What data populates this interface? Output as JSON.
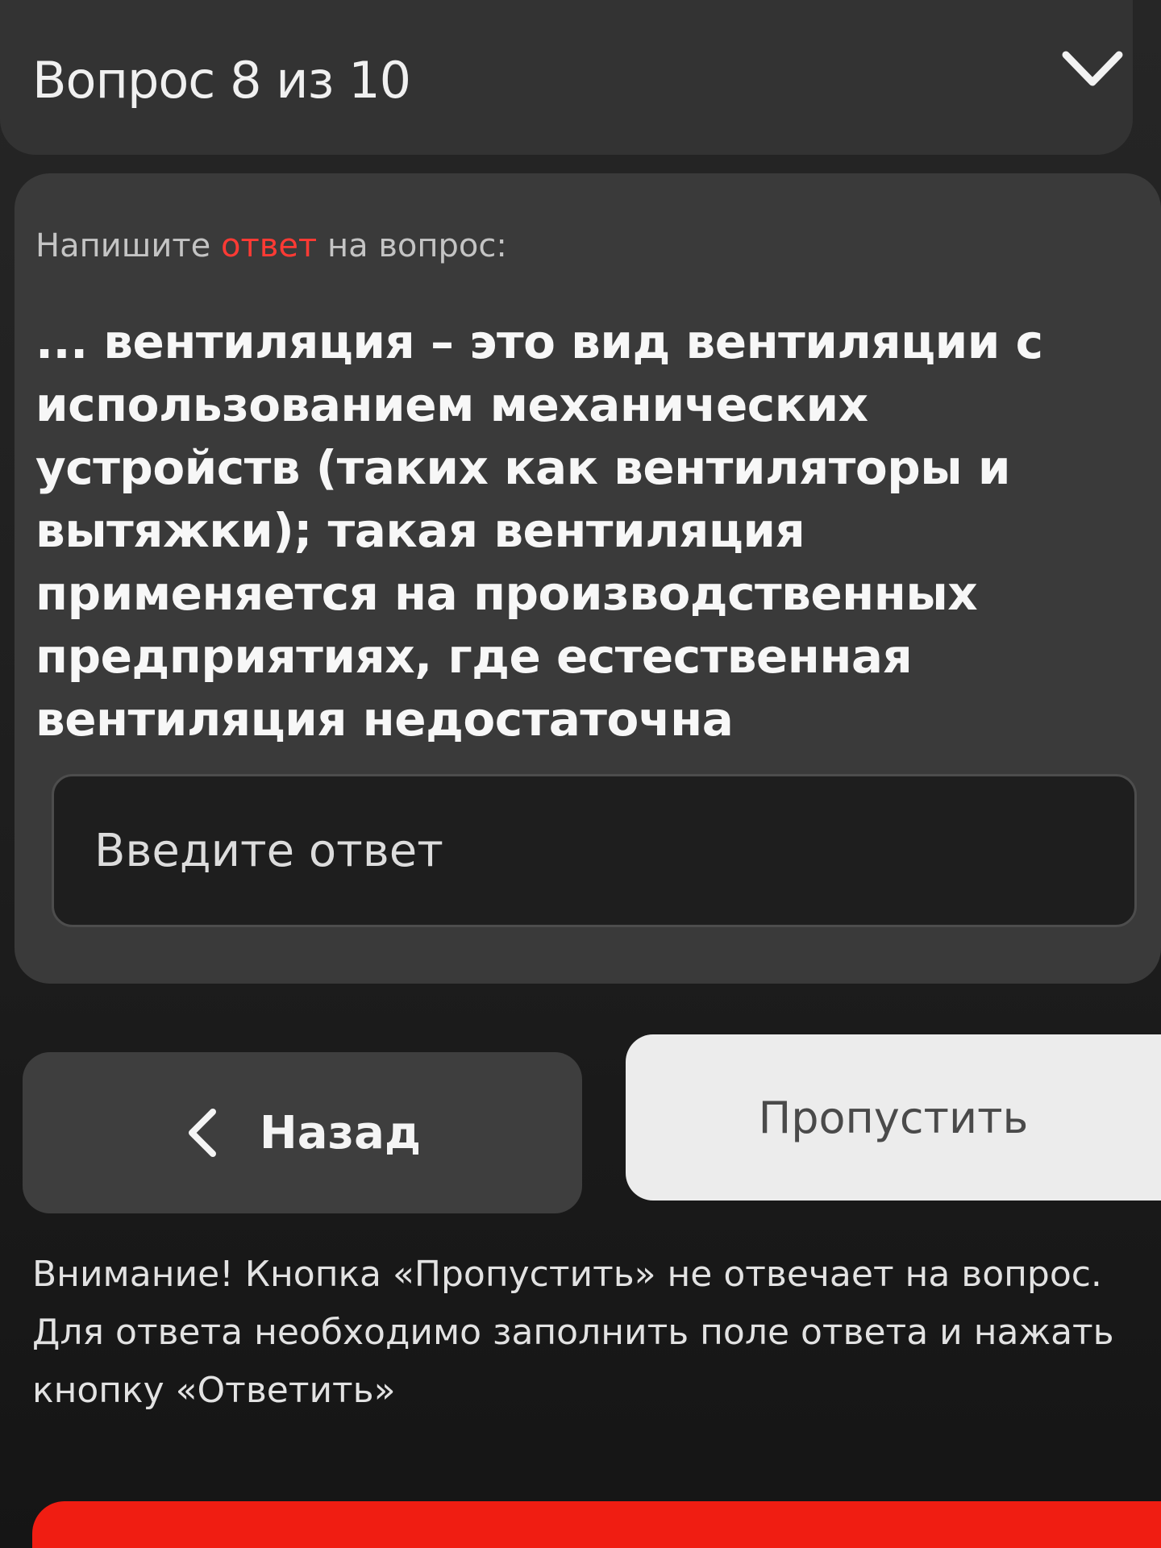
{
  "header": {
    "title": "Вопрос 8 из 10",
    "toggle_icon": "chevron-down-icon"
  },
  "question": {
    "instruction_prefix": "Напишите ",
    "instruction_accent": "ответ",
    "instruction_suffix": " на вопрос:",
    "text": "... вентиляция – это вид вентиляции с использованием механических устройств (таких как вентиляторы и вытяжки); такая вентиляция применяется на производственных предприятиях, где естественная вентиляция недостаточна"
  },
  "answer_input": {
    "placeholder": "Введите ответ",
    "value": ""
  },
  "buttons": {
    "back_label": "Назад",
    "back_icon": "chevron-left-icon",
    "skip_label": "Пропустить"
  },
  "warning": "Внимание! Кнопка «Пропустить» не отвечает на вопрос. Для ответа необходимо заполнить поле ответа и нажать кнопку «Ответить»",
  "colors": {
    "accent_red": "#ff3a34",
    "primary_button_red": "#f01d12",
    "card_bg": "#3a3a3a",
    "skip_bg": "#ececec"
  }
}
